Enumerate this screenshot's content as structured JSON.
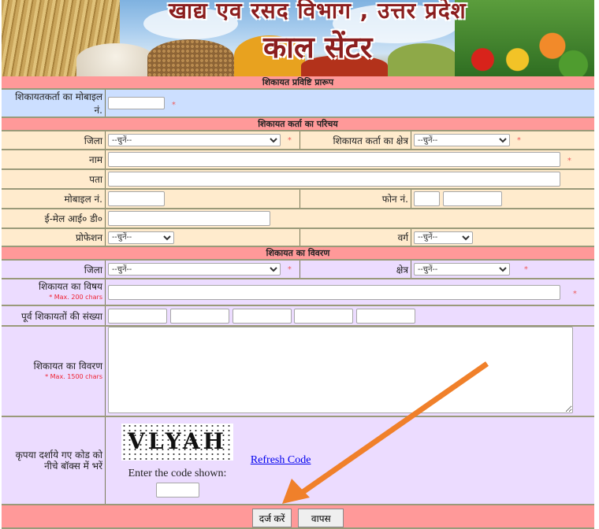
{
  "banner": {
    "title_line1": "खाद्य एव रसद विभाग , उत्तर प्रदेश",
    "title_line2": "काल सेंटर"
  },
  "form_title": "शिकायत प्रविष्टि प्रारूप",
  "complainant_mobile": {
    "label": "शिकायतकर्ता का मोबाइल नं.",
    "value": "",
    "required_mark": "*"
  },
  "section_complainant": {
    "title": "शिकायत कर्ता का परिचय",
    "district": {
      "label": "जिला",
      "selected": "--चुनें--",
      "required_mark": "*"
    },
    "area": {
      "label": "शिकायत कर्ता का क्षेत्र",
      "selected": "--चुनें--",
      "required_mark": "*"
    },
    "name": {
      "label": "नाम",
      "value": "",
      "required_mark": "*"
    },
    "address": {
      "label": "पता",
      "value": ""
    },
    "mobile": {
      "label": "मोबाइल नं.",
      "value": ""
    },
    "phone": {
      "label": "फोन नं.",
      "std_code": "",
      "number": ""
    },
    "email": {
      "label": "ई-मेल आई० डी०",
      "value": ""
    },
    "profession": {
      "label": "प्रोफेशन",
      "selected": "--चुनें--"
    },
    "category": {
      "label": "वर्ग",
      "selected": "--चुनें--"
    }
  },
  "section_complaint": {
    "title": "शिकायत का विवरण",
    "district": {
      "label": "जिला",
      "selected": "--चुनें--",
      "required_mark": "*"
    },
    "area": {
      "label": "क्षेत्र",
      "selected": "--चुनें--",
      "required_mark": "*"
    },
    "subject": {
      "label": "शिकायत का विषय",
      "hint": "* Max. 200 chars",
      "value": "",
      "required_mark": "*"
    },
    "previous_count": {
      "label": "पूर्व शिकायतों की संख्या",
      "values": [
        "",
        "",
        "",
        "",
        ""
      ]
    },
    "details": {
      "label": "शिकायत का विवरण",
      "hint": "* Max. 1500 chars",
      "value": ""
    }
  },
  "captcha": {
    "label": "कृपया दर्शाये गए कोड को नीचे बॉक्स में भरें",
    "code_text": "VLYAH",
    "refresh_label": "Refresh Code",
    "enter_label": "Enter the code shown:",
    "value": ""
  },
  "buttons": {
    "submit": "दर्ज करें",
    "back": "वापस"
  },
  "annotation": {
    "arrow_color": "#f0802a",
    "arrow_target": "submit-button"
  },
  "colors": {
    "header_bg": "#ff9999",
    "blue_row": "#ccdfff",
    "beige_row": "#ffebcd",
    "lavender_row": "#ecdcff",
    "required": "#ef5b5b"
  }
}
